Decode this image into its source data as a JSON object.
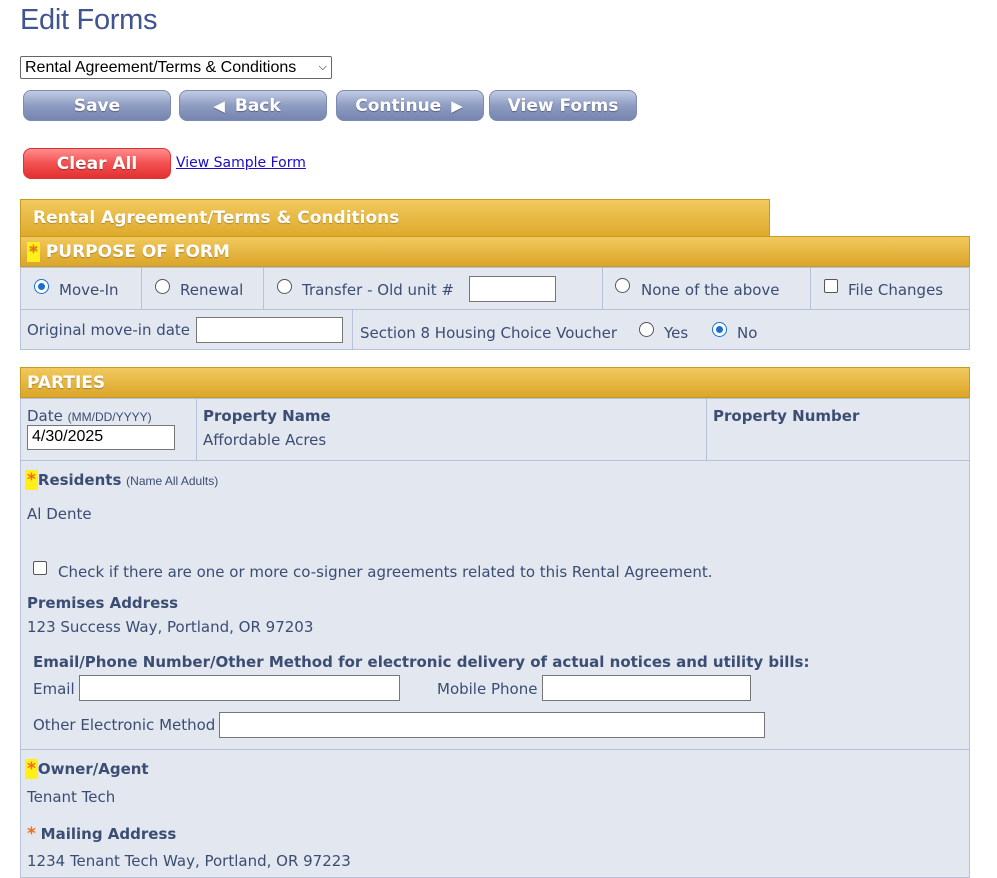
{
  "page": {
    "title": "Edit Forms"
  },
  "form_select": {
    "selected": "Rental Agreement/Terms & Conditions"
  },
  "toolbar": {
    "save": "Save",
    "back": "Back",
    "continue": "Continue",
    "view_forms": "View Forms",
    "clear_all": "Clear All",
    "view_sample": "View Sample Form"
  },
  "form": {
    "tab_title": "Rental Agreement/Terms & Conditions"
  },
  "purpose": {
    "header": "PURPOSE OF FORM",
    "options": {
      "move_in": "Move-In",
      "renewal": "Renewal",
      "transfer": "Transfer - Old unit #",
      "none": "None of the above"
    },
    "selected": "move_in",
    "file_changes": "File Changes",
    "original_move_in_label": "Original move-in date",
    "section8_label": "Section 8 Housing Choice Voucher",
    "yes": "Yes",
    "no": "No",
    "section8_selected": "no"
  },
  "parties": {
    "header": "PARTIES",
    "date_label": "Date",
    "date_format": "(MM/DD/YYYY)",
    "date_value": "4/30/2025",
    "property_name_label": "Property Name",
    "property_name": "Affordable Acres",
    "property_number_label": "Property Number",
    "residents_label": "Residents",
    "residents_note": "(Name All Adults)",
    "residents_value": "Al Dente",
    "cosigner_text": "Check if there are one or more co-signer agreements related to this Rental Agreement.",
    "premises_label": "Premises Address",
    "premises_value": "123 Success Way, Portland, OR 97203",
    "electronic_label": "Email/Phone Number/Other Method for electronic delivery of actual notices and utility bills:",
    "email_label": "Email",
    "mobile_label": "Mobile Phone",
    "other_label": "Other Electronic Method",
    "owner_label": "Owner/Agent",
    "owner_value": "Tenant Tech",
    "mailing_label": "Mailing Address",
    "mailing_value": "1234 Tenant Tech Way, Portland, OR 97223"
  },
  "colors": {
    "header_gold": "#deaa2c",
    "panel_blue": "#e2e7f0",
    "label_blue": "#3b4d72",
    "star_orange": "#f26b1d",
    "highlight_yellow": "#ffef1a"
  }
}
